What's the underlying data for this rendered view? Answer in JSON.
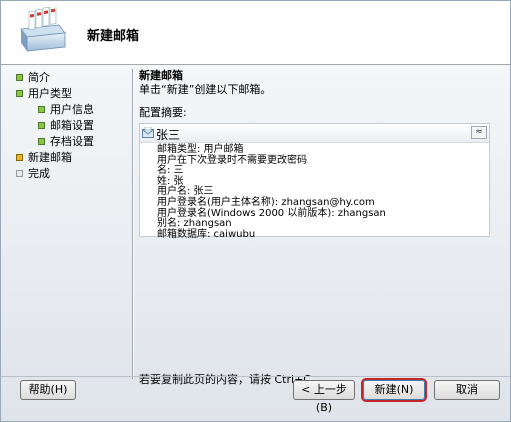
{
  "header": {
    "title": "新建邮箱",
    "icon": "mailbox-stack-icon"
  },
  "nav": [
    {
      "label": "简介",
      "level": 1,
      "state": "done"
    },
    {
      "label": "用户类型",
      "level": 1,
      "state": "done"
    },
    {
      "label": "用户信息",
      "level": 2,
      "state": "done"
    },
    {
      "label": "邮箱设置",
      "level": 2,
      "state": "done"
    },
    {
      "label": "存档设置",
      "level": 2,
      "state": "done"
    },
    {
      "label": "新建邮箱",
      "level": 1,
      "state": "current"
    },
    {
      "label": "完成",
      "level": 1,
      "state": "pending"
    }
  ],
  "content": {
    "title": "新建邮箱",
    "description": "单击“新建”创建以下邮箱。",
    "summary_label": "配置摘要:",
    "summary": {
      "name": "张三",
      "collapse_glyph": "≈",
      "lines": [
        "邮箱类型: 用户邮箱",
        "用户在下次登录时不需要更改密码",
        "名: 三",
        "姓: 张",
        "用户名: 张三",
        "用户登录名(用户主体名称): zhangsan@hy.com",
        "用户登录名(Windows 2000 以前版本): zhangsan",
        "别名: zhangsan",
        "邮箱数据库: caiwubu"
      ]
    },
    "copy_hint": "若要复制此页的内容，请按 Ctrl+C。"
  },
  "buttons": {
    "help": "帮助(H)",
    "back": "< 上一步(B)",
    "new": "新建(N)",
    "cancel": "取消"
  },
  "colors": {
    "done_bullet": "#8cc63f",
    "current_bullet": "#e6b82a",
    "pending_bullet": "#e9e9e9",
    "primary_button_ring": "#c2262b"
  }
}
